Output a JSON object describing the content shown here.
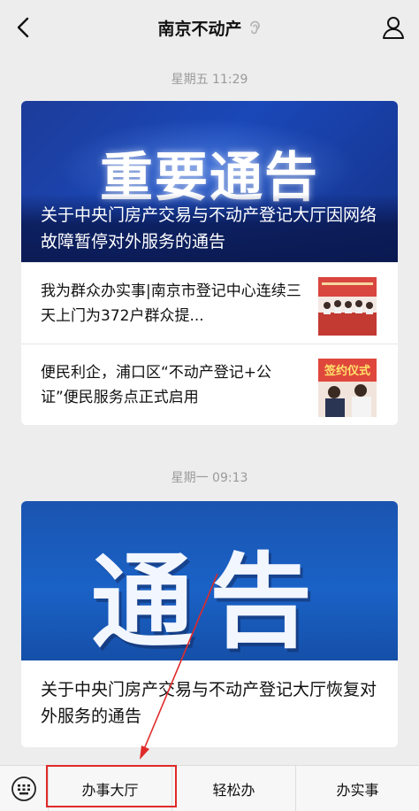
{
  "header": {
    "title": "南京不动产",
    "back_icon": "chevron-left-icon",
    "profile_icon": "person-icon",
    "ear_icon": "ear-icon"
  },
  "messages": [
    {
      "timestamp": "星期五 11:29",
      "banner_text": "重要通告",
      "headline": "关于中央门房产交易与不动产登记大厅因网络故障暂停对外服务的通告",
      "items": [
        {
          "text": "我为群众办实事|南京市登记中心连续三天上门为372户群众提..."
        },
        {
          "text": "便民利企，浦口区“不动产登记+公证”便民服务点正式启用"
        }
      ]
    },
    {
      "timestamp": "星期一 09:13",
      "banner_text": "通告",
      "headline": "关于中央门房产交易与不动产登记大厅恢复对外服务的通告"
    }
  ],
  "thumb_2_text": "签约仪式",
  "bottom_menu": {
    "keyboard_icon": "keyboard-icon",
    "items": [
      "办事大厅",
      "轻松办",
      "办实事"
    ]
  },
  "colors": {
    "annotation": "#e02a2a",
    "background": "#ededed"
  }
}
